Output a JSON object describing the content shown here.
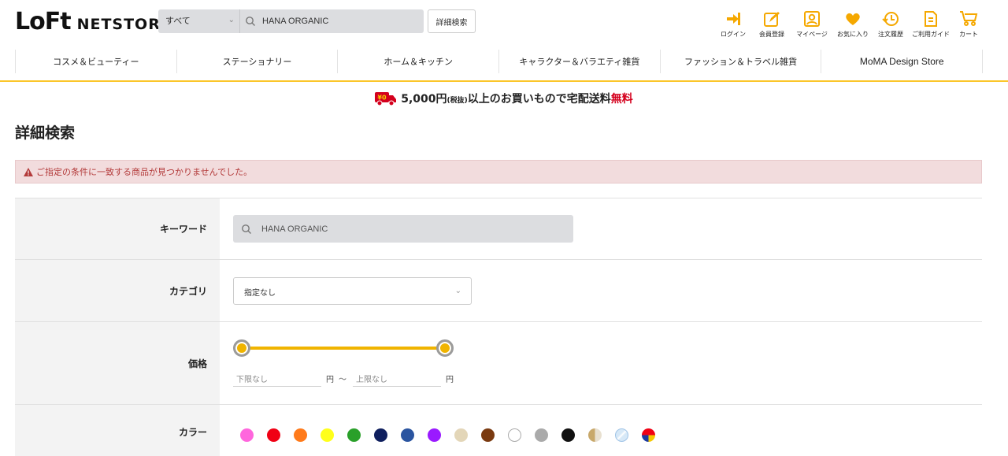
{
  "header": {
    "logo_main": "LoFt",
    "logo_sub": "NETSTORE",
    "search_scope": "すべて",
    "search_value": "HANA ORGANIC",
    "advanced_button": "詳細検索",
    "utility": [
      {
        "label": "ログイン",
        "icon": "login-icon"
      },
      {
        "label": "会員登録",
        "icon": "register-icon"
      },
      {
        "label": "マイページ",
        "icon": "mypage-icon"
      },
      {
        "label": "お気に入り",
        "icon": "heart-icon"
      },
      {
        "label": "注文履歴",
        "icon": "history-icon"
      },
      {
        "label": "ご利用ガイド",
        "icon": "guide-icon"
      },
      {
        "label": "カート",
        "icon": "cart-icon"
      }
    ],
    "accent_color": "#f5a800"
  },
  "nav": {
    "items": [
      "コスメ＆ビューティー",
      "ステーショナリー",
      "ホーム＆キッチン",
      "キャラクター＆バラエティ雑貨",
      "ファッション＆トラベル雑貨",
      "MoMA Design Store"
    ]
  },
  "promo": {
    "badge": "¥0",
    "amount": "5,000円",
    "tax": "(税抜)",
    "text": "以上のお買いもので宅配送料",
    "free": "無料"
  },
  "page_title": "詳細検索",
  "alert": {
    "message": "ご指定の条件に一致する商品が見つかりませんでした。"
  },
  "form": {
    "keyword_label": "キーワード",
    "keyword_value": "HANA ORGANIC",
    "category_label": "カテゴリ",
    "category_value": "指定なし",
    "price_label": "価格",
    "price_min_placeholder": "下限なし",
    "price_max_placeholder": "上限なし",
    "yen": "円",
    "tilde": "〜",
    "color_label": "カラー",
    "colors": [
      "#ff66dd",
      "#f00014",
      "#ff7a1a",
      "#ffff1a",
      "#2aa02a",
      "#0f1f5e",
      "#2a54a0",
      "#9a1aff",
      "#e3d6b8",
      "#7a3a10",
      "#ffffff",
      "#aaaaaa",
      "#111111",
      "gold",
      "clear",
      "multi"
    ]
  }
}
